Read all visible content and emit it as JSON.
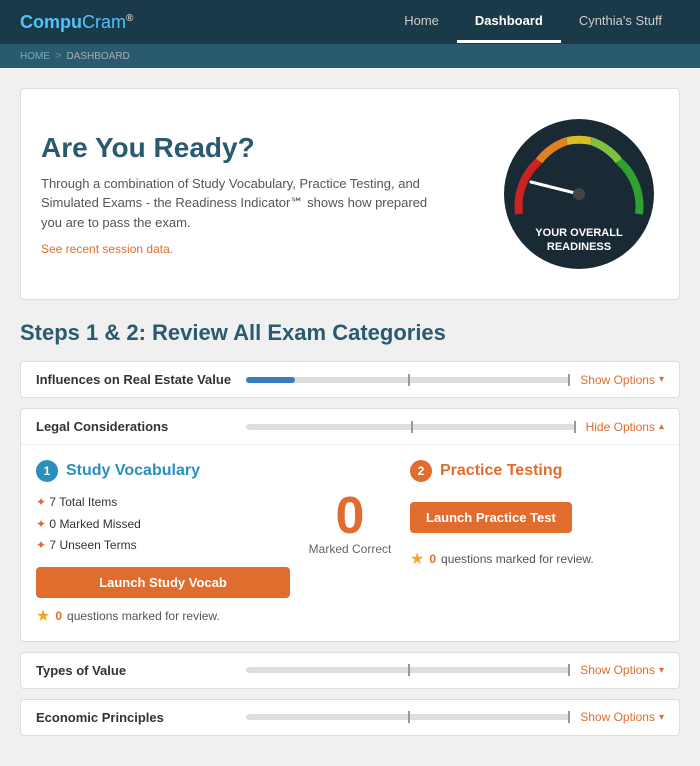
{
  "app": {
    "logo_text": "CompuCram",
    "logo_tm": "®"
  },
  "nav": {
    "items": [
      {
        "label": "Home",
        "active": false
      },
      {
        "label": "Dashboard",
        "active": true
      },
      {
        "label": "Cynthia's Stuff",
        "active": false
      }
    ]
  },
  "breadcrumb": {
    "home": "HOME",
    "separator": ">",
    "current": "DASHBOARD"
  },
  "hero": {
    "title": "Are You Ready?",
    "description": "Through a combination of Study Vocabulary, Practice Testing, and Simulated Exams - the Readiness Indicator℠ shows how prepared you are to pass the exam.",
    "see_data_link": "See recent session data."
  },
  "gauge": {
    "label_line1": "YOUR OVERALL",
    "label_line2": "READINESS"
  },
  "steps_title": "Steps 1 & 2: Review All Exam Categories",
  "categories": [
    {
      "name": "Influences on Real Estate Value",
      "progress": 15,
      "show_options": "Show Options",
      "expanded": false
    },
    {
      "name": "Legal Considerations",
      "progress": 0,
      "show_options": "Hide Options",
      "expanded": true,
      "col1": {
        "number": "1",
        "title": "Study Vocabulary",
        "total_items_label": "Total Items",
        "total_items": "7",
        "marked_missed_label": "Marked Missed",
        "marked_missed": "0",
        "unseen_label": "Unseen Terms",
        "unseen": "7",
        "btn_label": "Launch Study Vocab",
        "review_text": "questions marked for review.",
        "review_count": "0"
      },
      "col_middle": {
        "big_number": "0",
        "big_number_label": "Marked Correct"
      },
      "col2": {
        "number": "2",
        "title": "Practice Testing",
        "btn_label": "Launch Practice Test",
        "review_text": "questions marked for review.",
        "review_count": "0"
      }
    },
    {
      "name": "Types of Value",
      "progress": 0,
      "show_options": "Show Options",
      "expanded": false
    },
    {
      "name": "Economic Principles",
      "progress": 0,
      "show_options": "Show Options",
      "expanded": false
    }
  ]
}
